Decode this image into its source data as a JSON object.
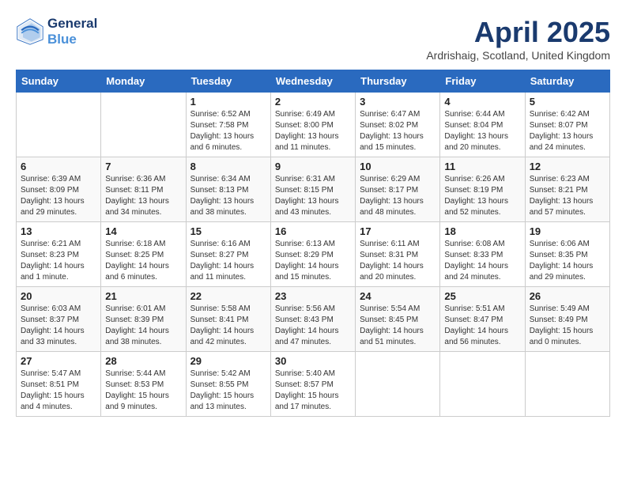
{
  "header": {
    "logo_line1": "General",
    "logo_line2": "Blue",
    "month_title": "April 2025",
    "location": "Ardrishaig, Scotland, United Kingdom"
  },
  "weekdays": [
    "Sunday",
    "Monday",
    "Tuesday",
    "Wednesday",
    "Thursday",
    "Friday",
    "Saturday"
  ],
  "weeks": [
    [
      {
        "day": "",
        "info": ""
      },
      {
        "day": "",
        "info": ""
      },
      {
        "day": "1",
        "info": "Sunrise: 6:52 AM\nSunset: 7:58 PM\nDaylight: 13 hours and 6 minutes."
      },
      {
        "day": "2",
        "info": "Sunrise: 6:49 AM\nSunset: 8:00 PM\nDaylight: 13 hours and 11 minutes."
      },
      {
        "day": "3",
        "info": "Sunrise: 6:47 AM\nSunset: 8:02 PM\nDaylight: 13 hours and 15 minutes."
      },
      {
        "day": "4",
        "info": "Sunrise: 6:44 AM\nSunset: 8:04 PM\nDaylight: 13 hours and 20 minutes."
      },
      {
        "day": "5",
        "info": "Sunrise: 6:42 AM\nSunset: 8:07 PM\nDaylight: 13 hours and 24 minutes."
      }
    ],
    [
      {
        "day": "6",
        "info": "Sunrise: 6:39 AM\nSunset: 8:09 PM\nDaylight: 13 hours and 29 minutes."
      },
      {
        "day": "7",
        "info": "Sunrise: 6:36 AM\nSunset: 8:11 PM\nDaylight: 13 hours and 34 minutes."
      },
      {
        "day": "8",
        "info": "Sunrise: 6:34 AM\nSunset: 8:13 PM\nDaylight: 13 hours and 38 minutes."
      },
      {
        "day": "9",
        "info": "Sunrise: 6:31 AM\nSunset: 8:15 PM\nDaylight: 13 hours and 43 minutes."
      },
      {
        "day": "10",
        "info": "Sunrise: 6:29 AM\nSunset: 8:17 PM\nDaylight: 13 hours and 48 minutes."
      },
      {
        "day": "11",
        "info": "Sunrise: 6:26 AM\nSunset: 8:19 PM\nDaylight: 13 hours and 52 minutes."
      },
      {
        "day": "12",
        "info": "Sunrise: 6:23 AM\nSunset: 8:21 PM\nDaylight: 13 hours and 57 minutes."
      }
    ],
    [
      {
        "day": "13",
        "info": "Sunrise: 6:21 AM\nSunset: 8:23 PM\nDaylight: 14 hours and 1 minute."
      },
      {
        "day": "14",
        "info": "Sunrise: 6:18 AM\nSunset: 8:25 PM\nDaylight: 14 hours and 6 minutes."
      },
      {
        "day": "15",
        "info": "Sunrise: 6:16 AM\nSunset: 8:27 PM\nDaylight: 14 hours and 11 minutes."
      },
      {
        "day": "16",
        "info": "Sunrise: 6:13 AM\nSunset: 8:29 PM\nDaylight: 14 hours and 15 minutes."
      },
      {
        "day": "17",
        "info": "Sunrise: 6:11 AM\nSunset: 8:31 PM\nDaylight: 14 hours and 20 minutes."
      },
      {
        "day": "18",
        "info": "Sunrise: 6:08 AM\nSunset: 8:33 PM\nDaylight: 14 hours and 24 minutes."
      },
      {
        "day": "19",
        "info": "Sunrise: 6:06 AM\nSunset: 8:35 PM\nDaylight: 14 hours and 29 minutes."
      }
    ],
    [
      {
        "day": "20",
        "info": "Sunrise: 6:03 AM\nSunset: 8:37 PM\nDaylight: 14 hours and 33 minutes."
      },
      {
        "day": "21",
        "info": "Sunrise: 6:01 AM\nSunset: 8:39 PM\nDaylight: 14 hours and 38 minutes."
      },
      {
        "day": "22",
        "info": "Sunrise: 5:58 AM\nSunset: 8:41 PM\nDaylight: 14 hours and 42 minutes."
      },
      {
        "day": "23",
        "info": "Sunrise: 5:56 AM\nSunset: 8:43 PM\nDaylight: 14 hours and 47 minutes."
      },
      {
        "day": "24",
        "info": "Sunrise: 5:54 AM\nSunset: 8:45 PM\nDaylight: 14 hours and 51 minutes."
      },
      {
        "day": "25",
        "info": "Sunrise: 5:51 AM\nSunset: 8:47 PM\nDaylight: 14 hours and 56 minutes."
      },
      {
        "day": "26",
        "info": "Sunrise: 5:49 AM\nSunset: 8:49 PM\nDaylight: 15 hours and 0 minutes."
      }
    ],
    [
      {
        "day": "27",
        "info": "Sunrise: 5:47 AM\nSunset: 8:51 PM\nDaylight: 15 hours and 4 minutes."
      },
      {
        "day": "28",
        "info": "Sunrise: 5:44 AM\nSunset: 8:53 PM\nDaylight: 15 hours and 9 minutes."
      },
      {
        "day": "29",
        "info": "Sunrise: 5:42 AM\nSunset: 8:55 PM\nDaylight: 15 hours and 13 minutes."
      },
      {
        "day": "30",
        "info": "Sunrise: 5:40 AM\nSunset: 8:57 PM\nDaylight: 15 hours and 17 minutes."
      },
      {
        "day": "",
        "info": ""
      },
      {
        "day": "",
        "info": ""
      },
      {
        "day": "",
        "info": ""
      }
    ]
  ]
}
